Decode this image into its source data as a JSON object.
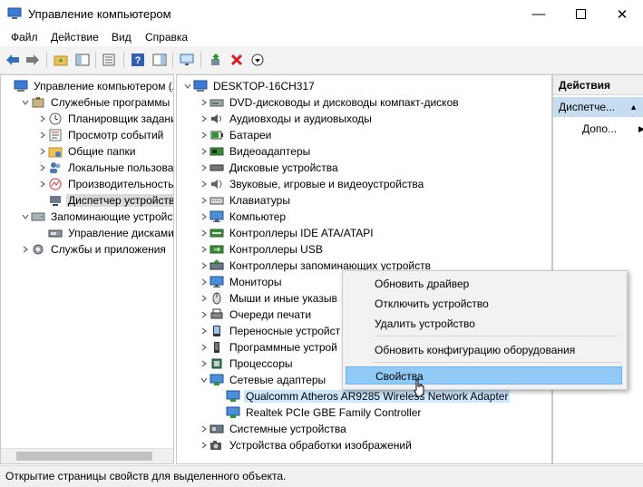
{
  "window": {
    "title": "Управление компьютером",
    "controls": [
      "minimize-icon",
      "maximize-icon",
      "close-icon"
    ]
  },
  "menu": [
    "Файл",
    "Действие",
    "Вид",
    "Справка"
  ],
  "toolbar": {
    "icons": [
      "back-arrow-icon",
      "forward-arrow-icon",
      "up-folder-icon",
      "show-hide-tree-icon",
      "properties-icon",
      "help-icon",
      "show-hide-action-pane-icon",
      "scan-hardware-icon",
      "update-driver-icon",
      "disable-device-icon",
      "uninstall-device-icon"
    ]
  },
  "left_tree": [
    {
      "label": "Управление компьютером (л",
      "icon": "computer-management-icon",
      "expander": "",
      "level": 0
    },
    {
      "label": "Служебные программы",
      "icon": "tools-icon",
      "expander": "▼",
      "level": 1
    },
    {
      "label": "Планировщик заданий",
      "icon": "clock-icon",
      "expander": ">",
      "level": 2
    },
    {
      "label": "Просмотр событий",
      "icon": "event-viewer-icon",
      "expander": ">",
      "level": 2
    },
    {
      "label": "Общие папки",
      "icon": "shared-folder-icon",
      "expander": ">",
      "level": 2
    },
    {
      "label": "Локальные пользовате",
      "icon": "users-icon",
      "expander": ">",
      "level": 2
    },
    {
      "label": "Производительность",
      "icon": "performance-icon",
      "expander": ">",
      "level": 2
    },
    {
      "label": "Диспетчер устройств",
      "icon": "device-manager-icon",
      "expander": "",
      "level": 2,
      "selected": true
    },
    {
      "label": "Запоминающие устройст",
      "icon": "storage-icon",
      "expander": "▼",
      "level": 1
    },
    {
      "label": "Управление дисками",
      "icon": "disk-management-icon",
      "expander": "",
      "level": 2
    },
    {
      "label": "Службы и приложения",
      "icon": "services-icon",
      "expander": ">",
      "level": 1
    }
  ],
  "device_tree": {
    "root": "DESKTOP-16CH317",
    "items": [
      {
        "label": "DVD-дисководы и дисководы компакт-дисков",
        "icon": "dvd-drive-icon",
        "expander": ">",
        "level": 1
      },
      {
        "label": "Аудиовходы и аудиовыходы",
        "icon": "speaker-icon",
        "expander": ">",
        "level": 1
      },
      {
        "label": "Батареи",
        "icon": "battery-icon",
        "expander": ">",
        "level": 1
      },
      {
        "label": "Видеоадаптеры",
        "icon": "display-adapter-icon",
        "expander": ">",
        "level": 1
      },
      {
        "label": "Дисковые устройства",
        "icon": "disk-drive-icon",
        "expander": ">",
        "level": 1
      },
      {
        "label": "Звуковые, игровые и видеоустройства",
        "icon": "sound-icon",
        "expander": ">",
        "level": 1
      },
      {
        "label": "Клавиатуры",
        "icon": "keyboard-icon",
        "expander": ">",
        "level": 1
      },
      {
        "label": "Компьютер",
        "icon": "monitor-icon",
        "expander": ">",
        "level": 1
      },
      {
        "label": "Контроллеры IDE ATA/ATAPI",
        "icon": "ide-controller-icon",
        "expander": ">",
        "level": 1
      },
      {
        "label": "Контроллеры USB",
        "icon": "usb-icon",
        "expander": ">",
        "level": 1
      },
      {
        "label": "Контроллеры запоминающих устройств",
        "icon": "storage-controller-icon",
        "expander": ">",
        "level": 1
      },
      {
        "label": "Мониторы",
        "icon": "monitor-icon",
        "expander": ">",
        "level": 1
      },
      {
        "label": "Мыши и иные указыв",
        "icon": "mouse-icon",
        "expander": ">",
        "level": 1
      },
      {
        "label": "Очереди печати",
        "icon": "printer-icon",
        "expander": ">",
        "level": 1
      },
      {
        "label": "Переносные устройст",
        "icon": "portable-device-icon",
        "expander": ">",
        "level": 1
      },
      {
        "label": "Программные устрой",
        "icon": "software-device-icon",
        "expander": ">",
        "level": 1
      },
      {
        "label": "Процессоры",
        "icon": "processor-icon",
        "expander": ">",
        "level": 1
      },
      {
        "label": "Сетевые адаптеры",
        "icon": "network-adapter-icon",
        "expander": "▼",
        "level": 1
      },
      {
        "label": "Qualcomm Atheros AR9285 Wireless Network Adapter",
        "icon": "network-adapter-icon",
        "expander": "",
        "level": 2,
        "highlighted": true
      },
      {
        "label": "Realtek PCIe GBE Family Controller",
        "icon": "network-adapter-icon",
        "expander": "",
        "level": 2
      },
      {
        "label": "Системные устройства",
        "icon": "system-device-icon",
        "expander": ">",
        "level": 1
      },
      {
        "label": "Устройства обработки изображений",
        "icon": "camera-icon",
        "expander": ">",
        "level": 1
      }
    ]
  },
  "actions": {
    "header": "Действия",
    "selected": "Диспетче...",
    "sub": "Допо..."
  },
  "context_menu": [
    {
      "label": "Обновить драйвер"
    },
    {
      "label": "Отключить устройство"
    },
    {
      "label": "Удалить устройство"
    },
    {
      "label": "Обновить конфигурацию оборудования"
    },
    {
      "label": "Свойства",
      "active": true
    }
  ],
  "status_text": "Открытие страницы свойств для выделенного объекта.",
  "colors": {
    "selection": "#91c9f7",
    "tree_highlight": "#cce8ff",
    "actions_selected": "#c6dcf1"
  }
}
